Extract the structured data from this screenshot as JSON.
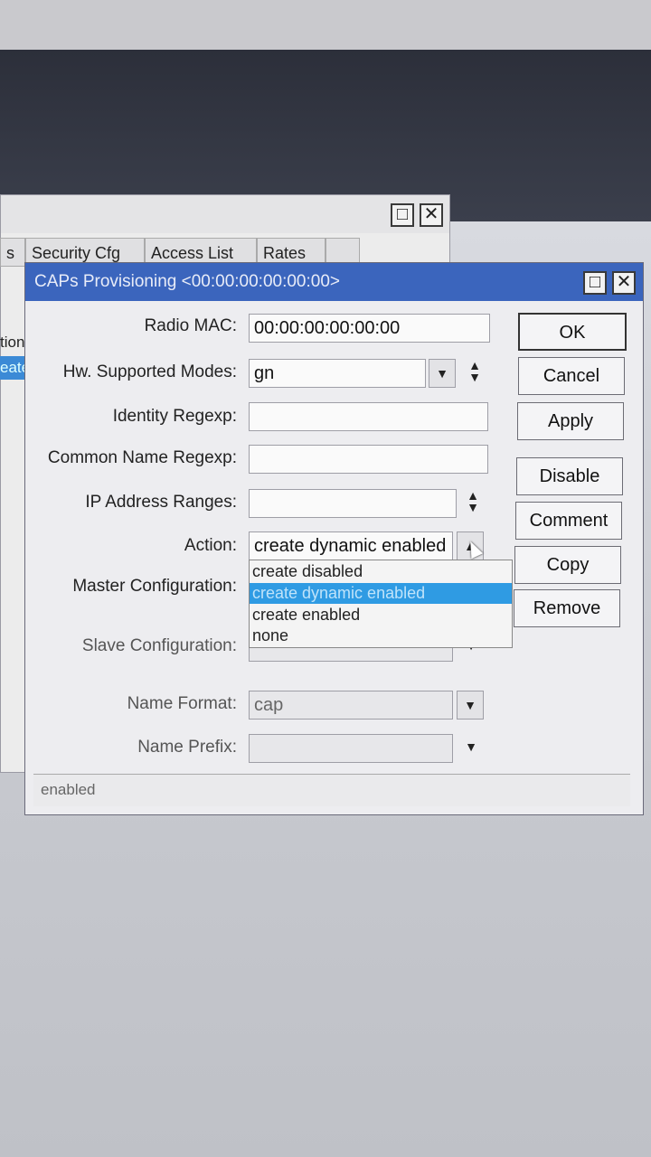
{
  "background_window": {
    "tabs": [
      "s",
      "Security Cfg",
      "Access List",
      "Rates",
      ""
    ],
    "rows": [
      "tion",
      "eate"
    ]
  },
  "dialog": {
    "title": "CAPs Provisioning <00:00:00:00:00:00>",
    "window_controls": {
      "maximize": "□",
      "close": "✕"
    },
    "fields": {
      "radio_mac": {
        "label": "Radio MAC:",
        "value": "00:00:00:00:00:00"
      },
      "hw_modes": {
        "label": "Hw. Supported Modes:",
        "value": "gn"
      },
      "identity_regexp": {
        "label": "Identity Regexp:",
        "value": ""
      },
      "common_name_regexp": {
        "label": "Common Name Regexp:",
        "value": ""
      },
      "ip_address_ranges": {
        "label": "IP Address Ranges:",
        "value": ""
      },
      "action": {
        "label": "Action:",
        "value": "create dynamic enabled"
      },
      "master_configuration": {
        "label": "Master Configuration:",
        "value": ""
      },
      "slave_configuration": {
        "label": "Slave Configuration:",
        "value": ""
      },
      "name_format": {
        "label": "Name Format:",
        "value": "cap"
      },
      "name_prefix": {
        "label": "Name Prefix:",
        "value": ""
      }
    },
    "action_options": [
      "create disabled",
      "create dynamic enabled",
      "create enabled",
      "none"
    ],
    "action_selected_index": 1,
    "buttons": {
      "ok": "OK",
      "cancel": "Cancel",
      "apply": "Apply",
      "disable": "Disable",
      "comment": "Comment",
      "copy": "Copy",
      "remove": "Remove"
    },
    "status": "enabled"
  },
  "colors": {
    "titlebar": "#3b65bd",
    "selection": "#2f9be3"
  }
}
